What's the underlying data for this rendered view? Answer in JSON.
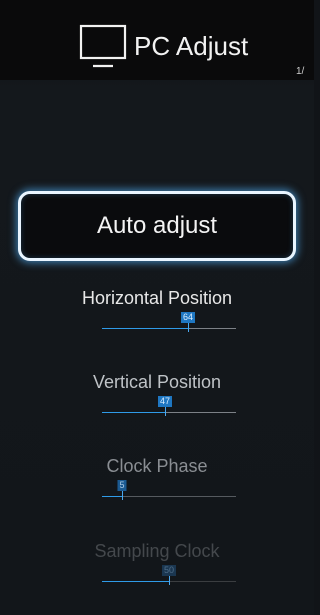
{
  "header": {
    "title": "PC Adjust",
    "page_indicator": "1/",
    "icon": "monitor-icon"
  },
  "auto_adjust": {
    "label": "Auto adjust"
  },
  "settings": [
    {
      "label": "Horizontal Position",
      "value": "64",
      "fraction": 0.64
    },
    {
      "label": "Vertical Position",
      "value": "47",
      "fraction": 0.47
    },
    {
      "label": "Clock Phase",
      "value": "5",
      "fraction": 0.15
    },
    {
      "label": "Sampling Clock",
      "value": "50",
      "fraction": 0.5
    }
  ],
  "colors": {
    "accent": "#2f9be8",
    "highlight_border": "#e9f5ff",
    "background": "#111418"
  }
}
